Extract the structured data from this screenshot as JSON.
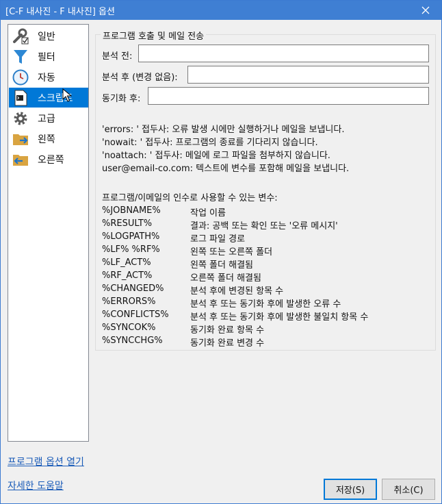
{
  "window": {
    "title": "[C-F 내사진 - F 내사진] 옵션"
  },
  "sidebar": {
    "items": [
      {
        "label": "일반"
      },
      {
        "label": "필터"
      },
      {
        "label": "자동"
      },
      {
        "label": "스크립트"
      },
      {
        "label": "고급"
      },
      {
        "label": "왼쪽"
      },
      {
        "label": "오른쪽"
      }
    ],
    "selected": "스크립트"
  },
  "group": {
    "title": "프로그램 호출 및 메일 전송",
    "fields": [
      {
        "label": "분석 전:",
        "value": ""
      },
      {
        "label": "분석 후 (변경 없음):",
        "value": ""
      },
      {
        "label": "동기화 후:",
        "value": ""
      }
    ],
    "help_lines": [
      "'errors: ' 접두사: 오류 발생 시에만 실행하거나 메일을 보냅니다.",
      "'nowait: ' 접두사: 프로그램의 종료를 기다리지 않습니다.",
      "'noattach: ' 접두사: 메일에 로그 파일을 첨부하지 않습니다.",
      "user@email-co.com: 텍스트에 변수를 포함해 메일을 보냅니다."
    ],
    "variables_heading": "프로그램/이메일의 인수로 사용할 수 있는 변수:",
    "variables": [
      {
        "name": "%JOBNAME%",
        "desc": "작업 이름"
      },
      {
        "name": "%RESULT%",
        "desc": "결과: 공백 또는 확인 또는 '오류 메시지'"
      },
      {
        "name": "%LOGPATH%",
        "desc": "로그 파일 경로"
      },
      {
        "name": "%LF% %RF%",
        "desc": "왼쪽 또는 오른쪽 폴더"
      },
      {
        "name": "%LF_ACT%",
        "desc": "왼쪽 폴더 해결됨"
      },
      {
        "name": "%RF_ACT%",
        "desc": "오른쪽 폴더 해결됨"
      },
      {
        "name": "%CHANGED%",
        "desc": "분석 후에 변경된 항목 수"
      },
      {
        "name": "%ERRORS%",
        "desc": "분석 후 또는 동기화 후에 발생한 오류 수"
      },
      {
        "name": "%CONFLICTS%",
        "desc": "분석 후 또는 동기화 후에 발생한 불일치 항목 수"
      },
      {
        "name": "%SYNCOK%",
        "desc": "동기화 완료 항목 수"
      },
      {
        "name": "%SYNCCHG%",
        "desc": "동기화 완료 변경 수"
      }
    ]
  },
  "links": {
    "open_options": "프로그램 옵션 열기",
    "detailed_help": "자세한 도움말"
  },
  "buttons": {
    "save": "저장(S)",
    "cancel": "취소(C)"
  },
  "colors": {
    "titlebar": "#3f7fd3",
    "selection": "#0078d7",
    "link": "#1a5bb8"
  }
}
